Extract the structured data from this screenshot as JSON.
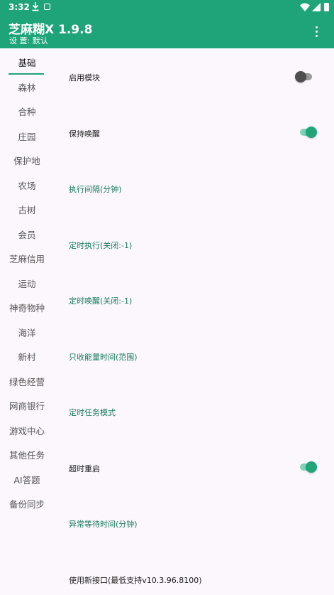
{
  "status_bar": {
    "time": "3:32",
    "icons": [
      "download-icon",
      "notification-icon",
      "wifi-icon",
      "signal-icon",
      "battery-icon"
    ]
  },
  "app_bar": {
    "title": "芝麻糊X 1.9.8",
    "subtitle": "设 置: 默认",
    "menu_icon": "more-vert-icon"
  },
  "colors": {
    "primary": "#1fa47a",
    "background": "#fbf7fd",
    "link_text": "#167a5b",
    "switch_on": "#20a478",
    "switch_off": "#4e4e4e"
  },
  "sidebar": {
    "active_index": 0,
    "items": [
      {
        "label": "基础"
      },
      {
        "label": "森林"
      },
      {
        "label": "合种"
      },
      {
        "label": "庄园"
      },
      {
        "label": "保护地"
      },
      {
        "label": "农场"
      },
      {
        "label": "古树"
      },
      {
        "label": "会员"
      },
      {
        "label": "芝麻信用"
      },
      {
        "label": "运动"
      },
      {
        "label": "神奇物种"
      },
      {
        "label": "海洋"
      },
      {
        "label": "新村"
      },
      {
        "label": "绿色经营"
      },
      {
        "label": "网商银行"
      },
      {
        "label": "游戏中心"
      },
      {
        "label": "其他任务"
      },
      {
        "label": "AI答题"
      },
      {
        "label": "备份同步"
      }
    ]
  },
  "settings": {
    "enable_module": {
      "label": "启用模块",
      "enabled": false
    },
    "keep_awake": {
      "label": "保持唤醒",
      "enabled": true
    },
    "exec_interval": {
      "label": "执行间隔(分钟)"
    },
    "timed_exec": {
      "label": "定时执行(关闭:-1)"
    },
    "timed_wake": {
      "label": "定时唤醒(关闭:-1)"
    },
    "energy_time": {
      "label": "只收能量时间(范围)"
    },
    "task_mode": {
      "label": "定时任务模式"
    },
    "timeout_restart": {
      "label": "超时重启",
      "enabled": true
    },
    "error_wait": {
      "label": "异常等待时间(分钟)"
    },
    "new_api": {
      "label": "使用新接口(最低支持v10.3.96.8100)"
    }
  }
}
